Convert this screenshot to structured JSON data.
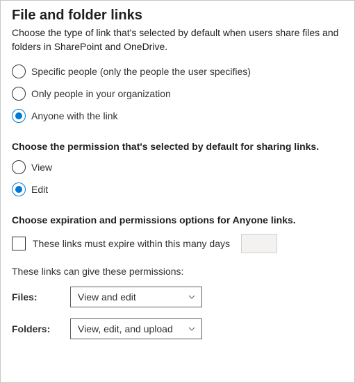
{
  "title": "File and folder links",
  "description": "Choose the type of link that's selected by default when users share files and folders in SharePoint and OneDrive.",
  "linkType": {
    "options": [
      {
        "label": "Specific people (only the people the user specifies)",
        "selected": false
      },
      {
        "label": "Only people in your organization",
        "selected": false
      },
      {
        "label": "Anyone with the link",
        "selected": true
      }
    ]
  },
  "permissionSection": {
    "heading": "Choose the permission that's selected by default for sharing links.",
    "options": [
      {
        "label": "View",
        "selected": false
      },
      {
        "label": "Edit",
        "selected": true
      }
    ]
  },
  "expirationSection": {
    "heading": "Choose expiration and permissions options for Anyone links.",
    "expireCheckbox": {
      "label": "These links must expire within this many days",
      "checked": false,
      "value": ""
    },
    "permissionsText": "These links can give these permissions:",
    "files": {
      "label": "Files:",
      "selected": "View and edit"
    },
    "folders": {
      "label": "Folders:",
      "selected": "View, edit, and upload"
    }
  }
}
